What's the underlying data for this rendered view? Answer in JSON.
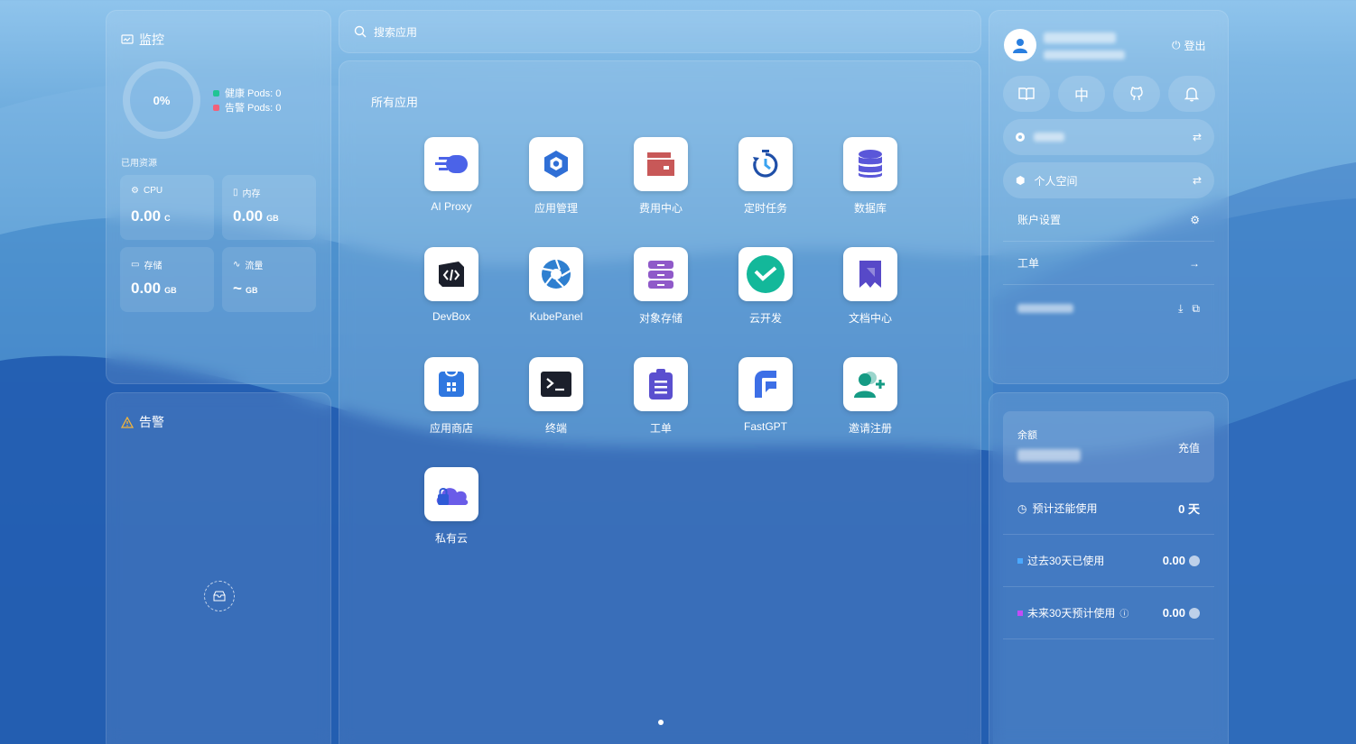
{
  "monitor": {
    "title": "监控",
    "ring_value": "0%",
    "healthy_pods": "健康 Pods: 0",
    "alert_pods": "告警 Pods: 0",
    "resources_label": "已用资源",
    "cards": [
      {
        "label": "CPU",
        "value": "0.00",
        "unit": "C"
      },
      {
        "label": "内存",
        "value": "0.00",
        "unit": "GB"
      },
      {
        "label": "存储",
        "value": "0.00",
        "unit": "GB"
      },
      {
        "label": "流量",
        "value": "~",
        "unit": "GB"
      }
    ]
  },
  "alerts": {
    "title": "告警"
  },
  "search": {
    "placeholder": "搜索应用"
  },
  "apps": {
    "title": "所有应用",
    "items": [
      {
        "label": "AI Proxy",
        "icon": "ai-proxy-icon"
      },
      {
        "label": "应用管理",
        "icon": "app-manage-icon"
      },
      {
        "label": "费用中心",
        "icon": "wallet-icon"
      },
      {
        "label": "定时任务",
        "icon": "timer-icon"
      },
      {
        "label": "数据库",
        "icon": "database-icon"
      },
      {
        "label": "DevBox",
        "icon": "devbox-icon"
      },
      {
        "label": "KubePanel",
        "icon": "aperture-icon"
      },
      {
        "label": "对象存储",
        "icon": "cabinet-icon"
      },
      {
        "label": "云开发",
        "icon": "cloud-dev-icon"
      },
      {
        "label": "文档中心",
        "icon": "bookmark-icon"
      },
      {
        "label": "应用商店",
        "icon": "store-bag-icon"
      },
      {
        "label": "终端",
        "icon": "terminal-icon"
      },
      {
        "label": "工单",
        "icon": "clipboard-icon"
      },
      {
        "label": "FastGPT",
        "icon": "fastgpt-icon"
      },
      {
        "label": "邀请注册",
        "icon": "invite-user-icon"
      },
      {
        "label": "私有云",
        "icon": "private-cloud-icon"
      }
    ]
  },
  "user": {
    "logout": "登出",
    "quick_buttons": [
      "book-icon",
      "中",
      "github-icon",
      "bell-icon"
    ],
    "personal_space": "个人空间",
    "account_settings": "账户设置",
    "ticket": "工单"
  },
  "billing": {
    "balance_label": "余额",
    "recharge": "充值",
    "remaining_label": "预计还能使用",
    "remaining_value": "0 天",
    "past_label": "过去30天已使用",
    "past_value": "0.00",
    "future_label": "未来30天预计使用",
    "future_value": "0.00",
    "colors": {
      "healthy": "#21c494",
      "alert": "#f2617a",
      "past": "#4aa8ff",
      "future": "#c24cf6"
    }
  }
}
